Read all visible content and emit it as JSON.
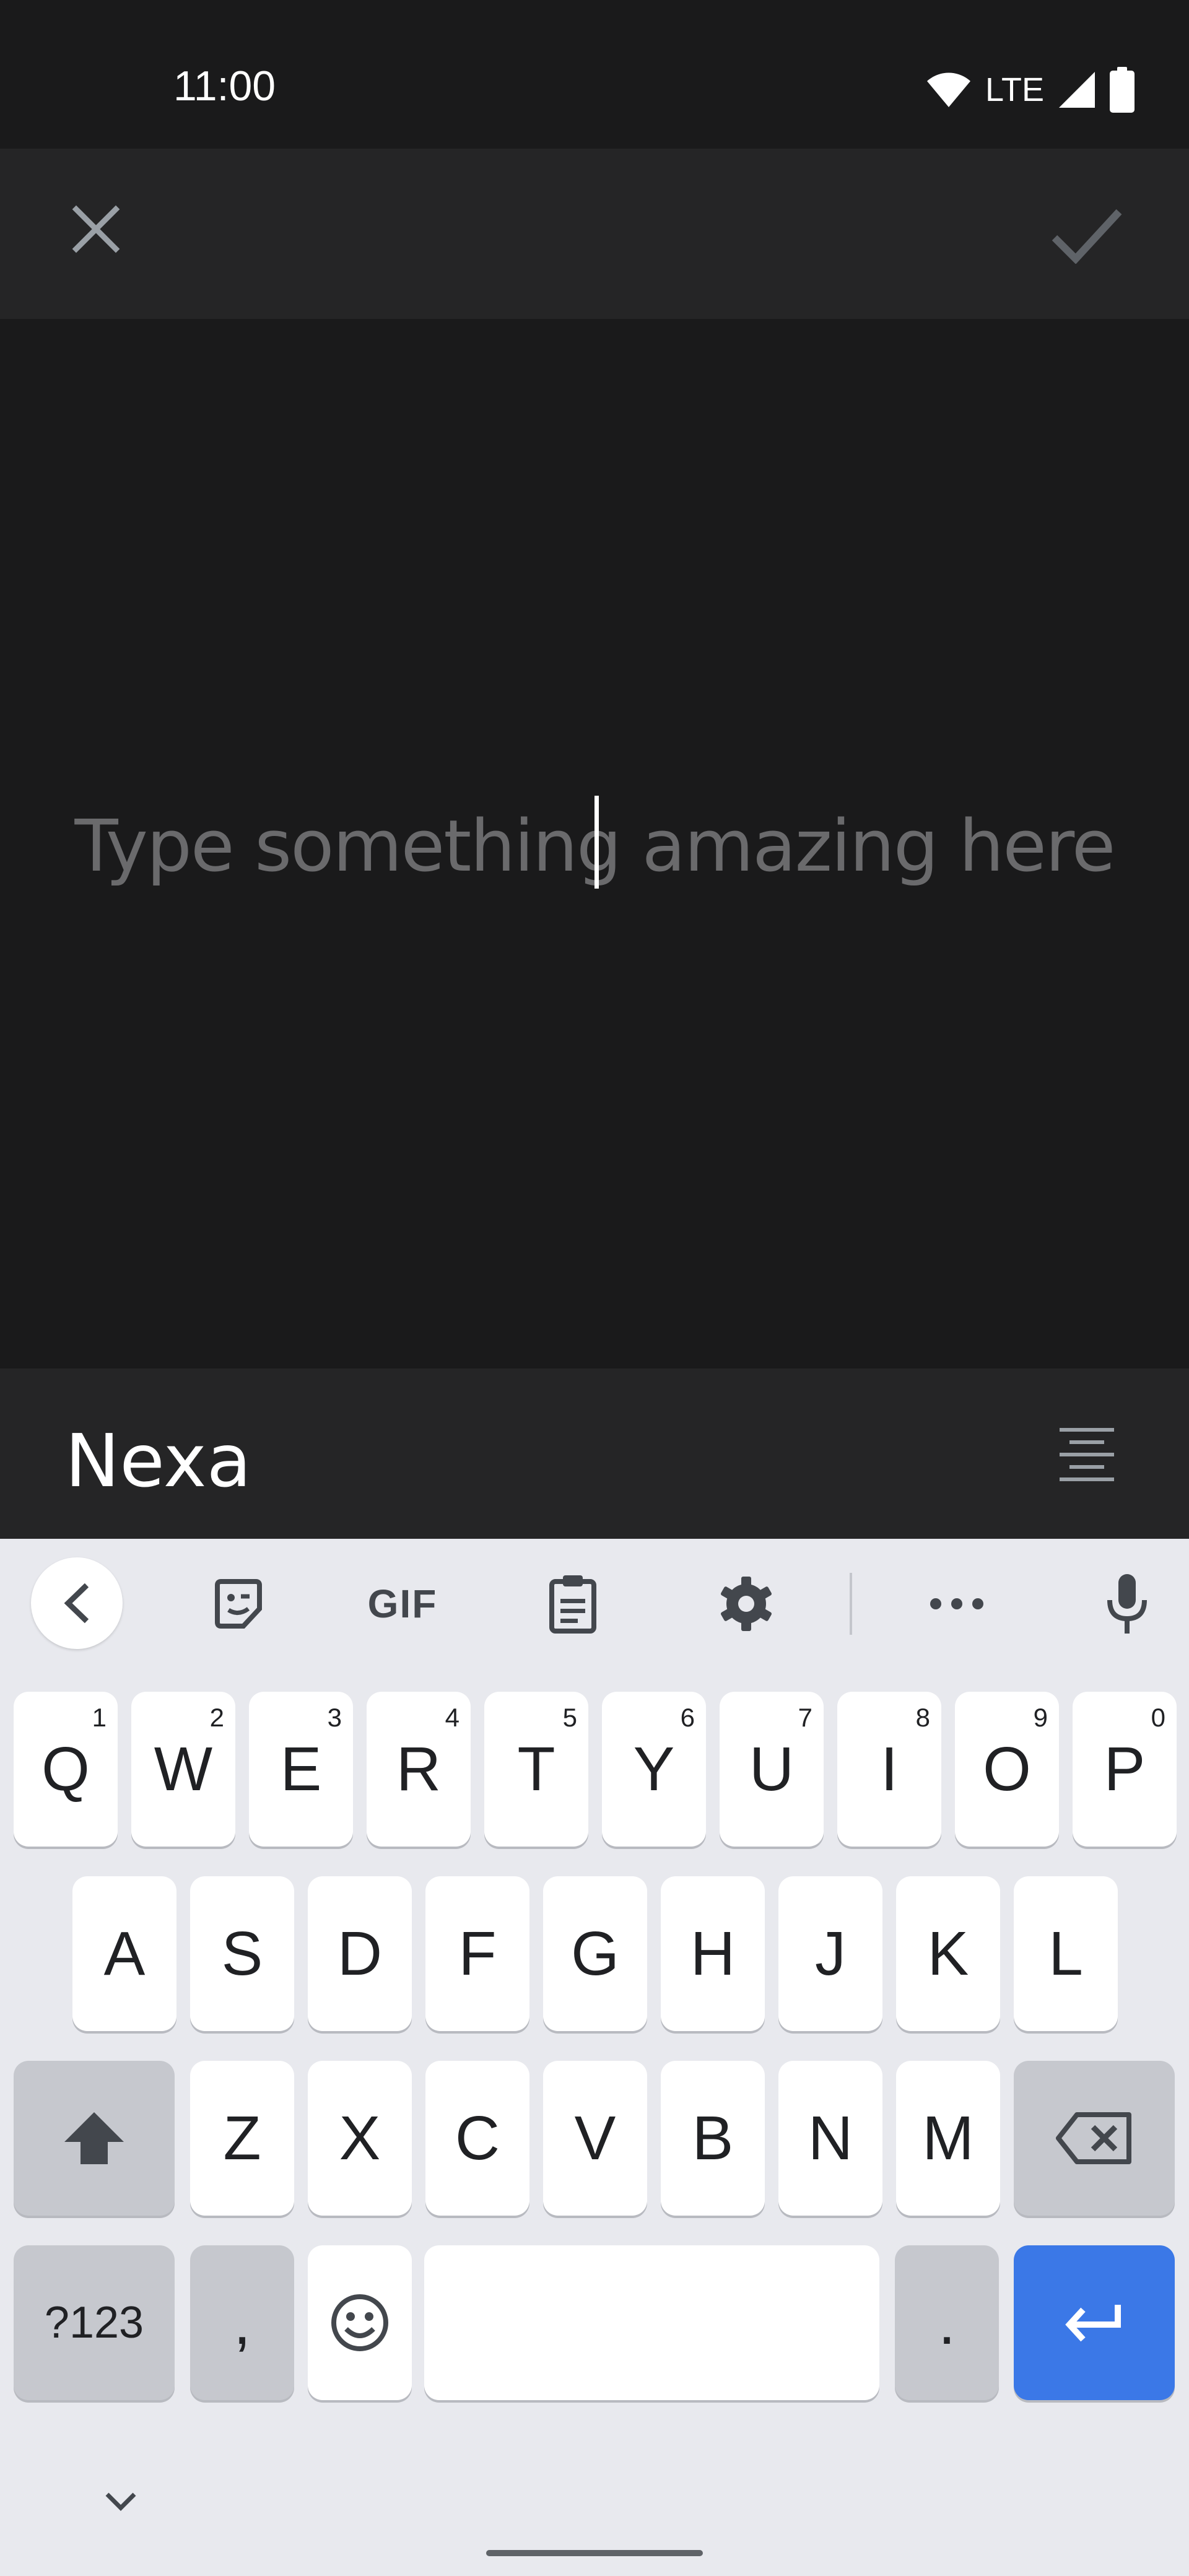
{
  "status_bar": {
    "time": "11:00",
    "network": "LTE"
  },
  "editor": {
    "placeholder": "Type something amazing here"
  },
  "font_bar": {
    "font_name": "Nexa"
  },
  "keyboard": {
    "toolbar": {
      "gif_label": "GIF"
    },
    "row1": [
      {
        "label": "Q",
        "hint": "1"
      },
      {
        "label": "W",
        "hint": "2"
      },
      {
        "label": "E",
        "hint": "3"
      },
      {
        "label": "R",
        "hint": "4"
      },
      {
        "label": "T",
        "hint": "5"
      },
      {
        "label": "Y",
        "hint": "6"
      },
      {
        "label": "U",
        "hint": "7"
      },
      {
        "label": "I",
        "hint": "8"
      },
      {
        "label": "O",
        "hint": "9"
      },
      {
        "label": "P",
        "hint": "0"
      }
    ],
    "row2": [
      "A",
      "S",
      "D",
      "F",
      "G",
      "H",
      "J",
      "K",
      "L"
    ],
    "row3": [
      "Z",
      "X",
      "C",
      "V",
      "B",
      "N",
      "M"
    ],
    "symbols_label": "?123",
    "comma_label": ",",
    "period_label": "."
  },
  "colors": {
    "accent": "#3b78e7",
    "background": "#1a1a1b",
    "bar": "#252526",
    "keyboard": "#e8e9ee"
  }
}
